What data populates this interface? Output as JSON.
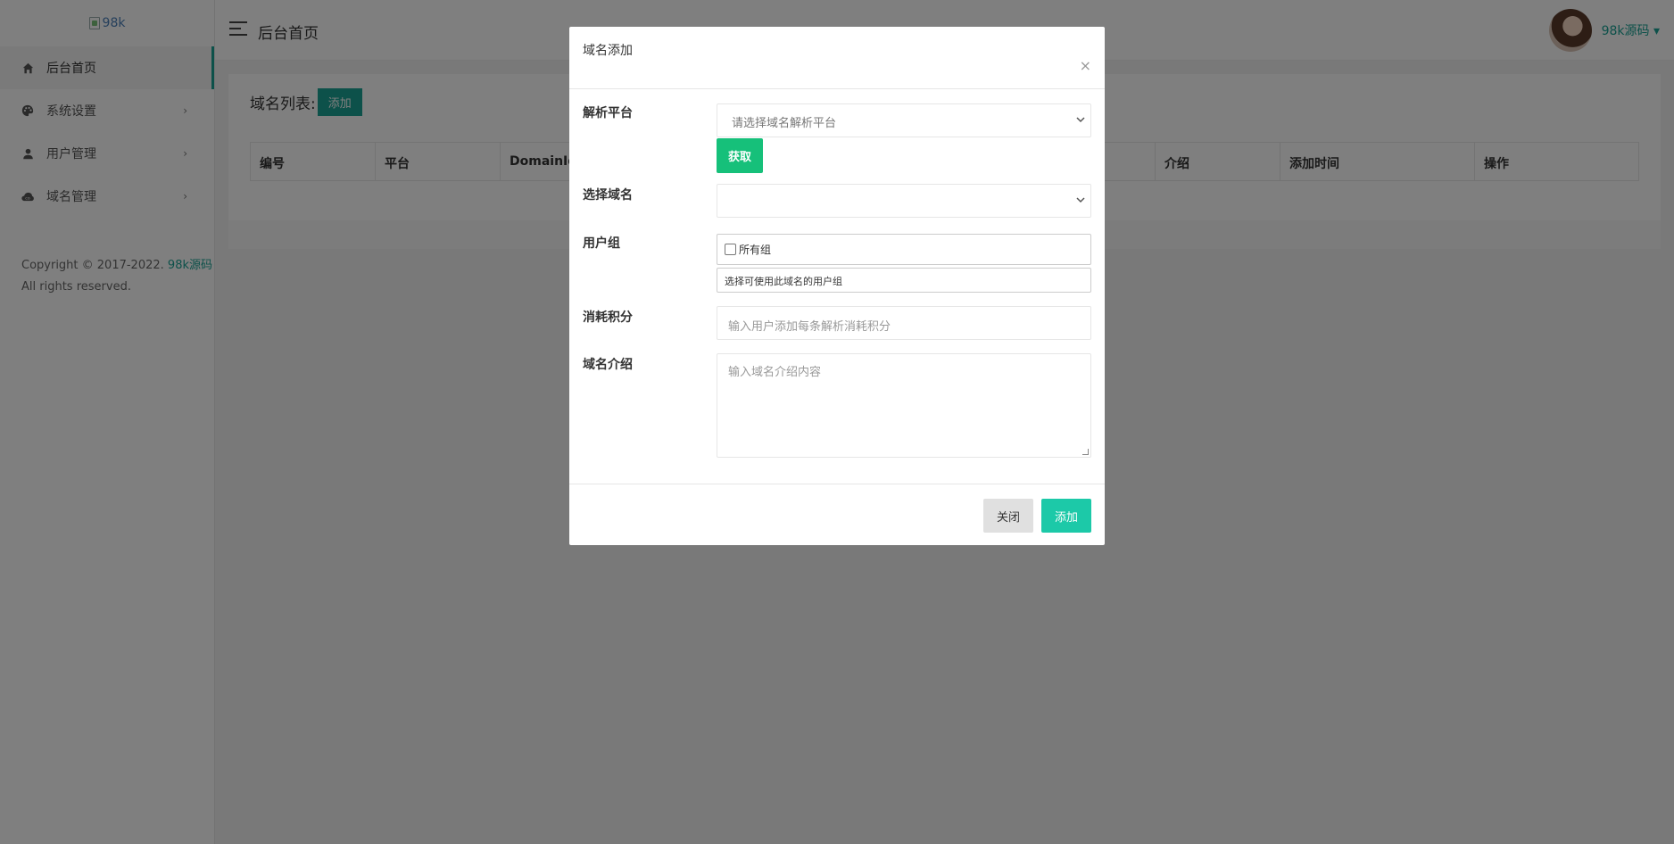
{
  "sidebar": {
    "logo_alt": "98k",
    "items": [
      {
        "label": "后台首页",
        "icon": "home-icon",
        "active": true,
        "has_arrow": false
      },
      {
        "label": "系统设置",
        "icon": "palette-icon",
        "active": false,
        "has_arrow": true
      },
      {
        "label": "用户管理",
        "icon": "user-icon",
        "active": false,
        "has_arrow": true
      },
      {
        "label": "域名管理",
        "icon": "cloud-icon",
        "active": false,
        "has_arrow": true
      }
    ],
    "arrow": "›",
    "copyright_prefix": "Copyright © 2017-2022.",
    "copyright_brand": "98k源码",
    "copyright_suffix": "All rights reserved."
  },
  "header": {
    "title": "后台首页",
    "user_name": "98k源码 ▾"
  },
  "panel": {
    "title": "域名列表:",
    "add_label": "添加",
    "columns": [
      "编号",
      "平台",
      "DomainId",
      "介绍",
      "添加时间",
      "操作"
    ]
  },
  "modal": {
    "title": "域名添加",
    "close": "×",
    "fields": {
      "platform_label": "解析平台",
      "platform_placeholder": "请选择域名解析平台",
      "fetch_label": "获取",
      "domain_label": "选择域名",
      "domain_value": "",
      "group_label": "用户组",
      "group_all": "所有组",
      "group_help": "选择可使用此域名的用户组",
      "points_label": "消耗积分",
      "points_placeholder": "输入用户添加每条解析消耗积分",
      "intro_label": "域名介绍",
      "intro_placeholder": "输入域名介绍内容"
    },
    "close_button": "关闭",
    "submit_button": "添加"
  },
  "colors": {
    "accent": "#1aa295",
    "fetch_button": "#16c07a",
    "submit_button": "#1cc9a8"
  }
}
